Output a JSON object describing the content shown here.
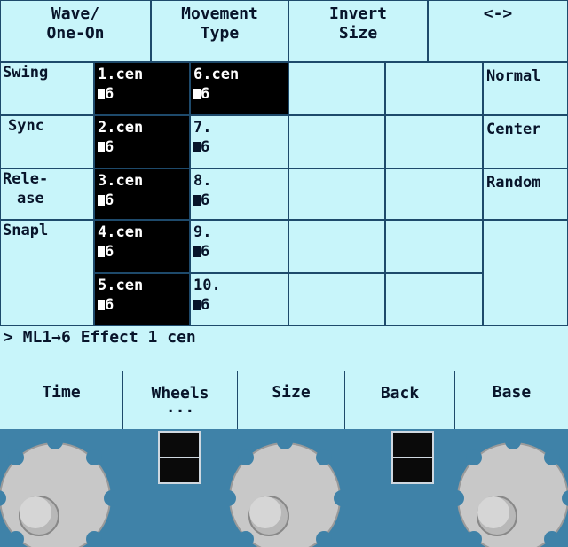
{
  "header": {
    "tabs": [
      {
        "line1": "Wave/",
        "line2": "One-On"
      },
      {
        "line1": "Movement",
        "line2": "Type"
      },
      {
        "line1": "Invert",
        "line2": "Size"
      },
      {
        "line1": "<->",
        "line2": ""
      }
    ]
  },
  "rows": {
    "labels": [
      {
        "line1": "Swing",
        "line2": ""
      },
      {
        "line1": "Sync",
        "line2": ""
      },
      {
        "line1": "Rele-",
        "line2": "ase"
      },
      {
        "line1": "Snapl",
        "line2": ""
      }
    ]
  },
  "effects": {
    "col1": [
      {
        "line1": "1.cen",
        "line2": "6"
      },
      {
        "line1": "2.cen",
        "line2": "6"
      },
      {
        "line1": "3.cen",
        "line2": "6"
      },
      {
        "line1": "4.cen",
        "line2": "6"
      },
      {
        "line1": "5.cen",
        "line2": "6"
      }
    ],
    "col2": [
      {
        "line1": "6.cen",
        "line2": "6"
      },
      {
        "line1": "7.",
        "line2": "6"
      },
      {
        "line1": "8.",
        "line2": "6"
      },
      {
        "line1": "9.",
        "line2": "6"
      },
      {
        "line1": "10.",
        "line2": "6"
      }
    ]
  },
  "options": [
    "Normal",
    "Center",
    "Random"
  ],
  "status": "> ML1→6 Effect 1 cen",
  "buttons": [
    {
      "label": "Time",
      "sub": ""
    },
    {
      "label": "Wheels",
      "sub": "..."
    },
    {
      "label": "Size",
      "sub": ""
    },
    {
      "label": "Back",
      "sub": ""
    },
    {
      "label": "Base",
      "sub": ""
    }
  ],
  "colors": {
    "screen": "#c8f5fa",
    "panel": "#3f82a8",
    "selected": "#000000",
    "grid": "#1e4a6b"
  }
}
